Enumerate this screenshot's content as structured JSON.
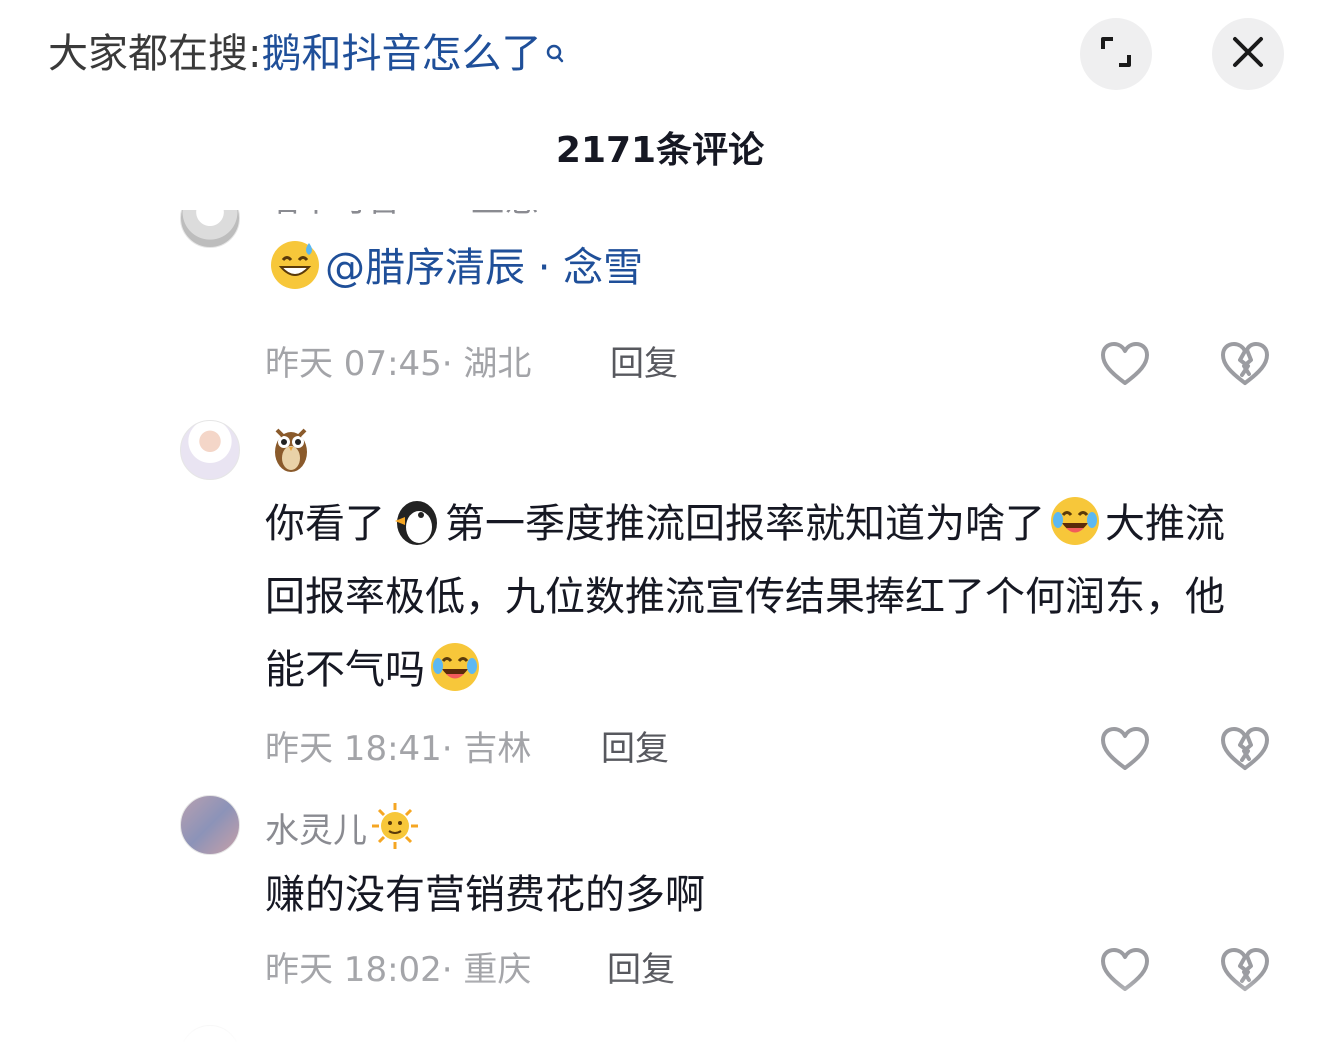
{
  "header": {
    "search_prefix": "大家都在搜:",
    "search_query": "鹅和抖音怎么了",
    "search_icon": "search-icon",
    "expand_icon": "expand-icon",
    "close_icon": "close-icon"
  },
  "comments_title": "2171条评论",
  "comments": [
    {
      "username": "喵不可言",
      "reply_to": "鱼愚",
      "text_prefix_emoji": "grinning-sweat-emoji",
      "mention": "@腊序清辰 · 念雪",
      "time": "昨天 07:45",
      "location": "湖北",
      "reply_label": "回复"
    },
    {
      "username_badge": "owl-emoji",
      "text_part1": "你看了",
      "text_emoji1": "penguin-emoji",
      "text_part2": "第一季度推流回报率就知道为啥了",
      "text_emoji2": "crying-laughing-emoji",
      "text_part3": "大推流回报率极低，九位数推流宣传结果捧红了个何润东，他能不气吗",
      "text_emoji3": "crying-laughing-emoji",
      "time": "昨天 18:41",
      "location": "吉林",
      "reply_label": "回复"
    },
    {
      "username": "水灵儿",
      "username_badge": "sun-face-emoji",
      "text": "赚的没有营销费花的多啊",
      "time": "昨天 18:02",
      "location": "重庆",
      "reply_label": "回复"
    }
  ],
  "colors": {
    "link_blue": "#1f4f99",
    "meta_gray": "#a3a4a8",
    "text_dark": "#161823"
  }
}
